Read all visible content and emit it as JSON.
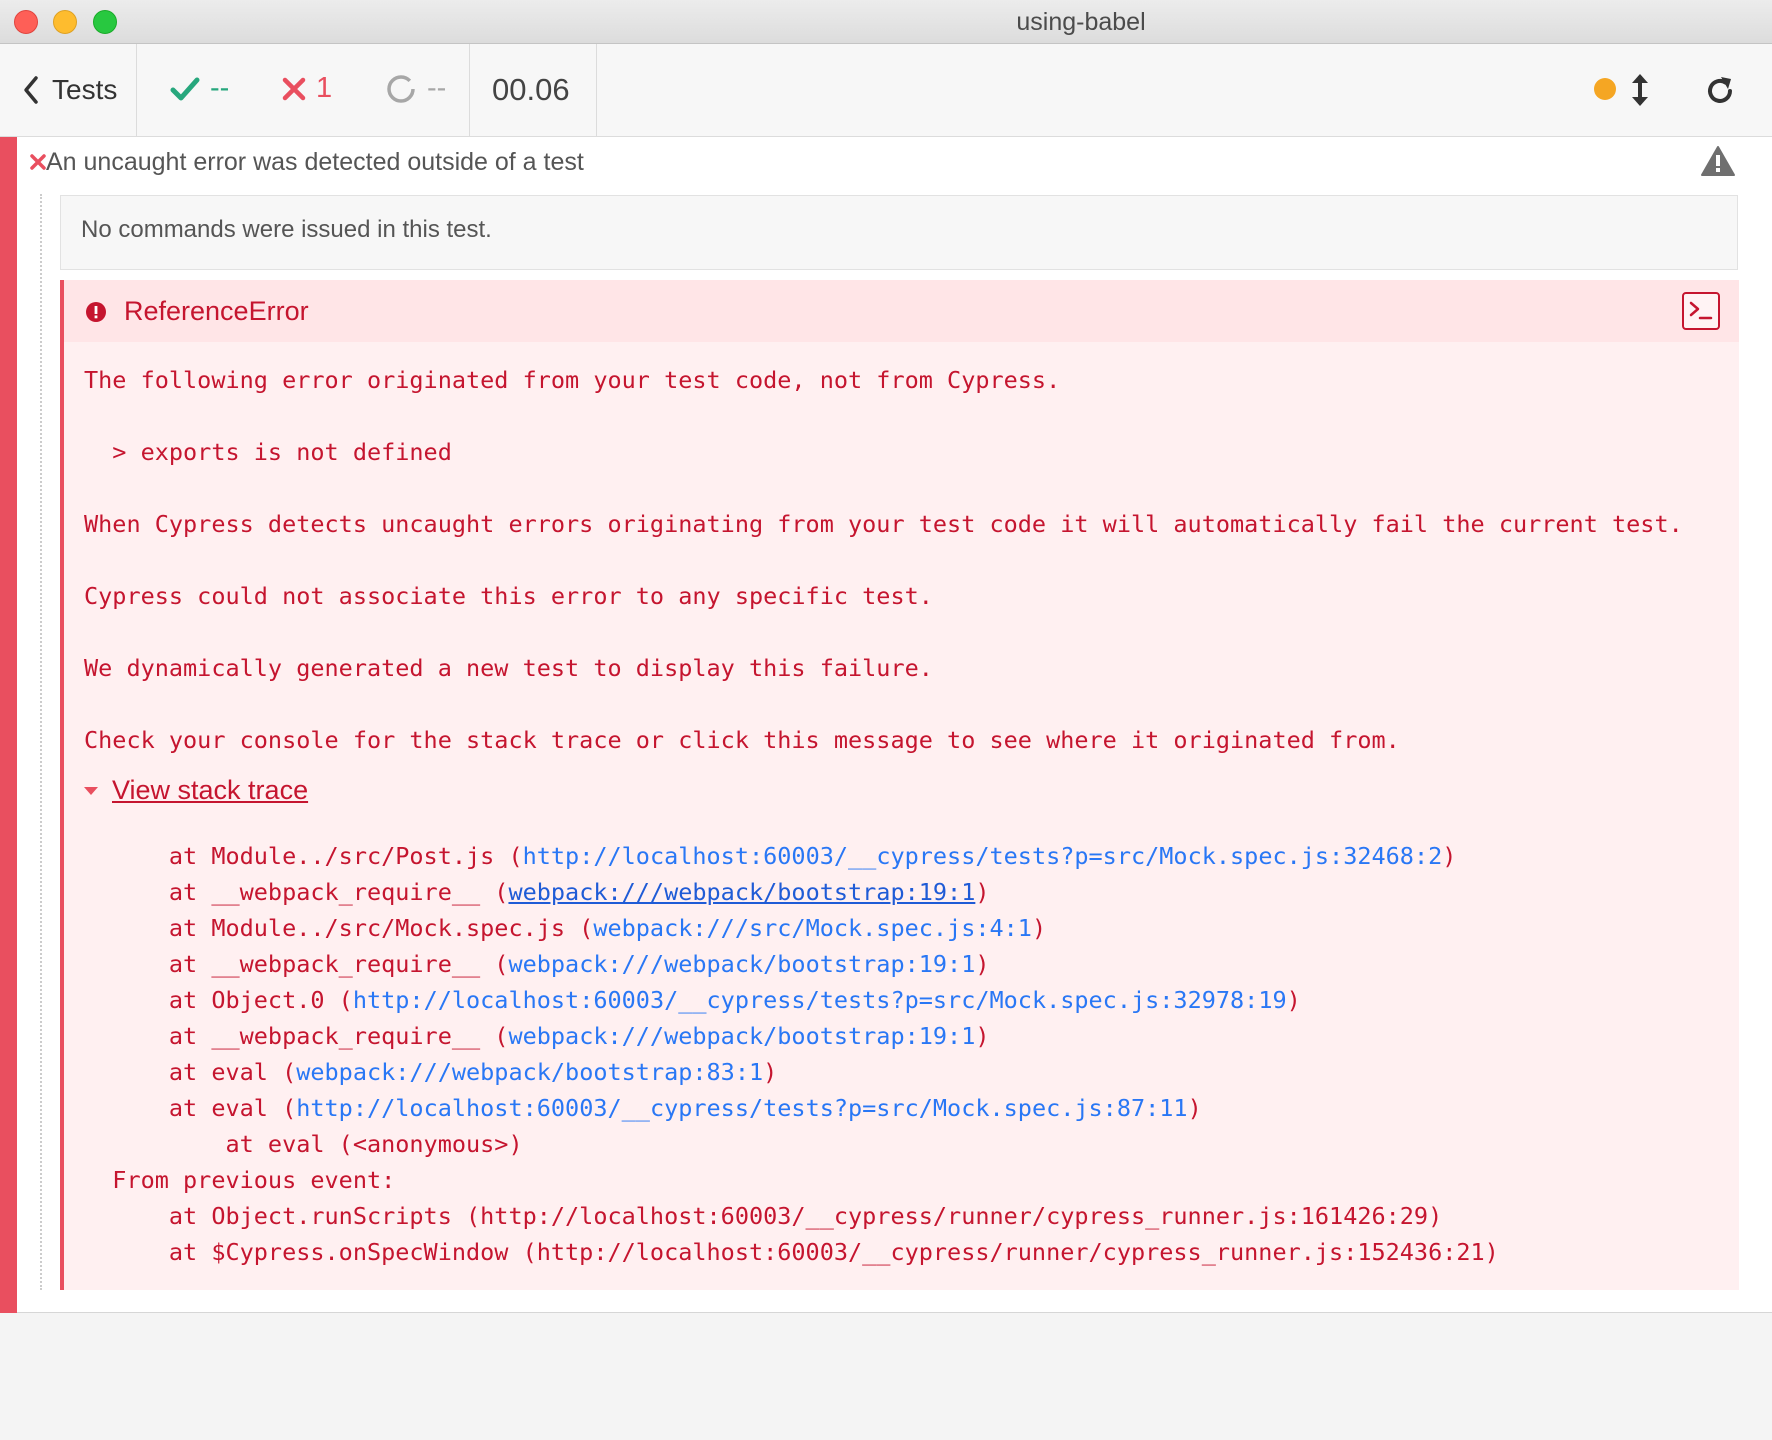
{
  "window": {
    "title": "using-babel"
  },
  "header": {
    "tests_label": "Tests",
    "passed": "--",
    "failed": "1",
    "pending": "--",
    "duration": "00.06"
  },
  "runnable": {
    "title": "An uncaught error was detected outside of a test",
    "no_commands": "No commands were issued in this test."
  },
  "error": {
    "name": "ReferenceError",
    "message_lines": [
      "The following error originated from your test code, not from Cypress.",
      "",
      "  > exports is not defined",
      "",
      "When Cypress detects uncaught errors originating from your test code it will automatically fail the current test.",
      "",
      "Cypress could not associate this error to any specific test.",
      "",
      "We dynamically generated a new test to display this failure.",
      "",
      "Check your console for the stack trace or click this message to see where it originated from."
    ],
    "stack_toggle": "View stack trace",
    "stack": [
      {
        "indent": "      ",
        "pre": "at Module../src/Post.js (",
        "link": "http://localhost:60003/__cypress/tests?p=src/Mock.spec.js:32468:2",
        "post": ")"
      },
      {
        "indent": "      ",
        "pre": "at __webpack_require__ (",
        "link": "webpack:///webpack/bootstrap:19:1",
        "post": ")",
        "hover": true
      },
      {
        "indent": "      ",
        "pre": "at Module../src/Mock.spec.js (",
        "link": "webpack:///src/Mock.spec.js:4:1",
        "post": ")"
      },
      {
        "indent": "      ",
        "pre": "at __webpack_require__ (",
        "link": "webpack:///webpack/bootstrap:19:1",
        "post": ")"
      },
      {
        "indent": "      ",
        "pre": "at Object.0 (",
        "link": "http://localhost:60003/__cypress/tests?p=src/Mock.spec.js:32978:19",
        "post": ")"
      },
      {
        "indent": "      ",
        "pre": "at __webpack_require__ (",
        "link": "webpack:///webpack/bootstrap:19:1",
        "post": ")"
      },
      {
        "indent": "      ",
        "pre": "at eval (",
        "link": "webpack:///webpack/bootstrap:83:1",
        "post": ")"
      },
      {
        "indent": "      ",
        "pre": "at eval (",
        "link": "http://localhost:60003/__cypress/tests?p=src/Mock.spec.js:87:11",
        "post": ")"
      },
      {
        "indent": "          ",
        "pre": "at eval (<anonymous>)",
        "link": "",
        "post": ""
      },
      {
        "indent": "  ",
        "pre": "From previous event:",
        "link": "",
        "post": ""
      },
      {
        "indent": "      ",
        "pre": "at Object.runScripts (http://localhost:60003/__cypress/runner/cypress_runner.js:161426:29)",
        "link": "",
        "post": ""
      },
      {
        "indent": "      ",
        "pre": "at $Cypress.onSpecWindow (http://localhost:60003/__cypress/runner/cypress_runner.js:152436:21)",
        "link": "",
        "post": ""
      }
    ]
  },
  "colors": {
    "failed": "#e94f5f",
    "passed": "#27a77d",
    "error_text": "#c5152f",
    "link": "#2977f5",
    "indicator": "#f5a623"
  },
  "icons": [
    "chevron-left-icon",
    "check-icon",
    "x-icon",
    "spinner-icon",
    "arrows-vertical-icon",
    "reload-icon",
    "warning-icon",
    "error-circle-icon",
    "terminal-icon",
    "caret-down-icon"
  ]
}
